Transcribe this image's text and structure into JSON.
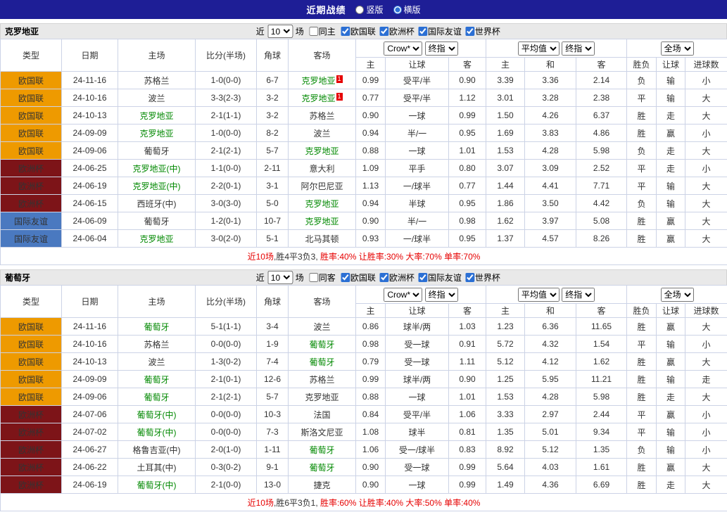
{
  "titlebar": {
    "title": "近期战绩",
    "vertical_label": "竖版",
    "horizontal_label": "横版",
    "selected_layout": "横版"
  },
  "colors": {
    "topbar": "#1e1e96",
    "league-nl": "#ee9a00",
    "league-euro": "#7d1418",
    "league-friendly": "#4a79c0",
    "result-red": "#e60000",
    "result-blue": "#2424dd",
    "result-green": "#009900",
    "team-green": "#008800",
    "score-red": "#ee0000"
  },
  "sections": [
    {
      "team": "克罗地亚",
      "filter": {
        "near_label": "近",
        "count": "10",
        "games_label": "场",
        "same_label": "同主",
        "same_checked": false,
        "competitions": [
          {
            "label": "欧国联",
            "checked": true
          },
          {
            "label": "欧洲杯",
            "checked": true
          },
          {
            "label": "国际友谊",
            "checked": true
          },
          {
            "label": "世界杯",
            "checked": true
          }
        ]
      },
      "header": {
        "type": "类型",
        "date": "日期",
        "home": "主场",
        "score": "比分(半场)",
        "corner": "角球",
        "away": "客场",
        "odds_source": "Crow*",
        "odds_kind": "终指",
        "avg_source": "平均值",
        "avg_kind": "终指",
        "full_source": "全场",
        "sub": [
          "主",
          "让球",
          "客",
          "主",
          "和",
          "客",
          "胜负",
          "让球",
          "进球数"
        ]
      },
      "rows": [
        {
          "type": "欧国联",
          "type_key": "nl",
          "date": "24-11-16",
          "home": "苏格兰",
          "home_green": false,
          "score": "1-0(0-0)",
          "corner": "6-7",
          "away": "克罗地亚",
          "away_green": true,
          "away_badge": "1",
          "odds": [
            "0.99",
            "受平/半",
            "0.90"
          ],
          "avg": [
            "3.39",
            "3.36",
            "2.14"
          ],
          "results": [
            {
              "text": "负",
              "color": "b"
            },
            {
              "text": "输",
              "color": "b"
            },
            {
              "text": "小",
              "color": "b"
            }
          ]
        },
        {
          "type": "欧国联",
          "type_key": "nl",
          "date": "24-10-16",
          "home": "波兰",
          "home_green": false,
          "score": "3-3(2-3)",
          "corner": "3-2",
          "away": "克罗地亚",
          "away_green": true,
          "away_badge": "1",
          "odds": [
            "0.77",
            "受平/半",
            "1.12"
          ],
          "avg": [
            "3.01",
            "3.28",
            "2.38"
          ],
          "results": [
            {
              "text": "平",
              "color": "b"
            },
            {
              "text": "输",
              "color": "b"
            },
            {
              "text": "大",
              "color": "r"
            }
          ]
        },
        {
          "type": "欧国联",
          "type_key": "nl",
          "date": "24-10-13",
          "home": "克罗地亚",
          "home_green": true,
          "score": "2-1(1-1)",
          "corner": "3-2",
          "away": "苏格兰",
          "away_green": false,
          "odds": [
            "0.90",
            "一球",
            "0.99"
          ],
          "avg": [
            "1.50",
            "4.26",
            "6.37"
          ],
          "results": [
            {
              "text": "胜",
              "color": "r"
            },
            {
              "text": "走",
              "color": "g"
            },
            {
              "text": "大",
              "color": "r"
            }
          ]
        },
        {
          "type": "欧国联",
          "type_key": "nl",
          "date": "24-09-09",
          "home": "克罗地亚",
          "home_green": true,
          "score": "1-0(0-0)",
          "corner": "8-2",
          "away": "波兰",
          "away_green": false,
          "odds": [
            "0.94",
            "半/一",
            "0.95"
          ],
          "avg": [
            "1.69",
            "3.83",
            "4.86"
          ],
          "results": [
            {
              "text": "胜",
              "color": "r"
            },
            {
              "text": "赢",
              "color": "r"
            },
            {
              "text": "小",
              "color": "b"
            }
          ]
        },
        {
          "type": "欧国联",
          "type_key": "nl",
          "date": "24-09-06",
          "home": "葡萄牙",
          "home_green": false,
          "score": "2-1(2-1)",
          "corner": "5-7",
          "away": "克罗地亚",
          "away_green": true,
          "odds": [
            "0.88",
            "一球",
            "1.01"
          ],
          "avg": [
            "1.53",
            "4.28",
            "5.98"
          ],
          "results": [
            {
              "text": "负",
              "color": "b"
            },
            {
              "text": "走",
              "color": "g"
            },
            {
              "text": "大",
              "color": "r"
            }
          ]
        },
        {
          "type": "欧洲杯",
          "type_key": "euro",
          "date": "24-06-25",
          "home": "克罗地亚(中)",
          "home_green": true,
          "score": "1-1(0-0)",
          "corner": "2-11",
          "away": "意大利",
          "away_green": false,
          "odds": [
            "1.09",
            "平手",
            "0.80"
          ],
          "avg": [
            "3.07",
            "3.09",
            "2.52"
          ],
          "results": [
            {
              "text": "平",
              "color": "b"
            },
            {
              "text": "走",
              "color": "g"
            },
            {
              "text": "小",
              "color": "b"
            }
          ]
        },
        {
          "type": "欧洲杯",
          "type_key": "euro",
          "date": "24-06-19",
          "home": "克罗地亚(中)",
          "home_green": true,
          "score": "2-2(0-1)",
          "corner": "3-1",
          "away": "阿尔巴尼亚",
          "away_green": false,
          "odds": [
            "1.13",
            "一/球半",
            "0.77"
          ],
          "avg": [
            "1.44",
            "4.41",
            "7.71"
          ],
          "results": [
            {
              "text": "平",
              "color": "b"
            },
            {
              "text": "输",
              "color": "b"
            },
            {
              "text": "大",
              "color": "r"
            }
          ]
        },
        {
          "type": "欧洲杯",
          "type_key": "euro",
          "date": "24-06-15",
          "home": "西班牙(中)",
          "home_green": false,
          "score": "3-0(3-0)",
          "corner": "5-0",
          "away": "克罗地亚",
          "away_green": true,
          "odds": [
            "0.94",
            "半球",
            "0.95"
          ],
          "avg": [
            "1.86",
            "3.50",
            "4.42"
          ],
          "results": [
            {
              "text": "负",
              "color": "b"
            },
            {
              "text": "输",
              "color": "b"
            },
            {
              "text": "大",
              "color": "r"
            }
          ]
        },
        {
          "type": "国际友谊",
          "type_key": "friendly",
          "date": "24-06-09",
          "home": "葡萄牙",
          "home_green": false,
          "score": "1-2(0-1)",
          "corner": "10-7",
          "away": "克罗地亚",
          "away_green": true,
          "odds": [
            "0.90",
            "半/一",
            "0.98"
          ],
          "avg": [
            "1.62",
            "3.97",
            "5.08"
          ],
          "results": [
            {
              "text": "胜",
              "color": "r"
            },
            {
              "text": "赢",
              "color": "r"
            },
            {
              "text": "大",
              "color": "r"
            }
          ]
        },
        {
          "type": "国际友谊",
          "type_key": "friendly",
          "date": "24-06-04",
          "home": "克罗地亚",
          "home_green": true,
          "score": "3-0(2-0)",
          "corner": "5-1",
          "away": "北马其顿",
          "away_green": false,
          "odds": [
            "0.93",
            "一/球半",
            "0.95"
          ],
          "avg": [
            "1.37",
            "4.57",
            "8.26"
          ],
          "results": [
            {
              "text": "胜",
              "color": "r"
            },
            {
              "text": "赢",
              "color": "r"
            },
            {
              "text": "大",
              "color": "r"
            }
          ]
        }
      ],
      "summary": [
        {
          "text": "近10场",
          "red": true
        },
        {
          "text": ",胜4平3负3, ",
          "red": false
        },
        {
          "text": "胜率:40% 让胜率:30% 大率:70% 单率:70%",
          "red": true
        }
      ]
    },
    {
      "team": "葡萄牙",
      "filter": {
        "near_label": "近",
        "count": "10",
        "games_label": "场",
        "same_label": "同客",
        "same_checked": false,
        "competitions": [
          {
            "label": "欧国联",
            "checked": true
          },
          {
            "label": "欧洲杯",
            "checked": true
          },
          {
            "label": "国际友谊",
            "checked": true
          },
          {
            "label": "世界杯",
            "checked": true
          }
        ]
      },
      "header": {
        "type": "类型",
        "date": "日期",
        "home": "主场",
        "score": "比分(半场)",
        "corner": "角球",
        "away": "客场",
        "odds_source": "Crow*",
        "odds_kind": "终指",
        "avg_source": "平均值",
        "avg_kind": "终指",
        "full_source": "全场",
        "sub": [
          "主",
          "让球",
          "客",
          "主",
          "和",
          "客",
          "胜负",
          "让球",
          "进球数"
        ]
      },
      "rows": [
        {
          "type": "欧国联",
          "type_key": "nl",
          "date": "24-11-16",
          "home": "葡萄牙",
          "home_green": true,
          "score": "5-1(1-1)",
          "corner": "3-4",
          "away": "波兰",
          "away_green": false,
          "odds": [
            "0.86",
            "球半/两",
            "1.03"
          ],
          "avg": [
            "1.23",
            "6.36",
            "11.65"
          ],
          "results": [
            {
              "text": "胜",
              "color": "r"
            },
            {
              "text": "赢",
              "color": "r"
            },
            {
              "text": "大",
              "color": "r"
            }
          ]
        },
        {
          "type": "欧国联",
          "type_key": "nl",
          "date": "24-10-16",
          "home": "苏格兰",
          "home_green": false,
          "score": "0-0(0-0)",
          "corner": "1-9",
          "away": "葡萄牙",
          "away_green": true,
          "odds": [
            "0.98",
            "受一球",
            "0.91"
          ],
          "avg": [
            "5.72",
            "4.32",
            "1.54"
          ],
          "results": [
            {
              "text": "平",
              "color": "b"
            },
            {
              "text": "输",
              "color": "b"
            },
            {
              "text": "小",
              "color": "b"
            }
          ]
        },
        {
          "type": "欧国联",
          "type_key": "nl",
          "date": "24-10-13",
          "home": "波兰",
          "home_green": false,
          "score": "1-3(0-2)",
          "corner": "7-4",
          "away": "葡萄牙",
          "away_green": true,
          "odds": [
            "0.79",
            "受一球",
            "1.11"
          ],
          "avg": [
            "5.12",
            "4.12",
            "1.62"
          ],
          "results": [
            {
              "text": "胜",
              "color": "r"
            },
            {
              "text": "赢",
              "color": "r"
            },
            {
              "text": "大",
              "color": "r"
            }
          ]
        },
        {
          "type": "欧国联",
          "type_key": "nl",
          "date": "24-09-09",
          "home": "葡萄牙",
          "home_green": true,
          "score": "2-1(0-1)",
          "corner": "12-6",
          "away": "苏格兰",
          "away_green": false,
          "odds": [
            "0.99",
            "球半/两",
            "0.90"
          ],
          "avg": [
            "1.25",
            "5.95",
            "11.21"
          ],
          "results": [
            {
              "text": "胜",
              "color": "r"
            },
            {
              "text": "输",
              "color": "b"
            },
            {
              "text": "走",
              "color": "g"
            }
          ]
        },
        {
          "type": "欧国联",
          "type_key": "nl",
          "date": "24-09-06",
          "home": "葡萄牙",
          "home_green": true,
          "score": "2-1(2-1)",
          "corner": "5-7",
          "away": "克罗地亚",
          "away_green": false,
          "odds": [
            "0.88",
            "一球",
            "1.01"
          ],
          "avg": [
            "1.53",
            "4.28",
            "5.98"
          ],
          "results": [
            {
              "text": "胜",
              "color": "r"
            },
            {
              "text": "走",
              "color": "g"
            },
            {
              "text": "大",
              "color": "r"
            }
          ]
        },
        {
          "type": "欧洲杯",
          "type_key": "euro",
          "date": "24-07-06",
          "home": "葡萄牙(中)",
          "home_green": true,
          "score": "0-0(0-0)",
          "corner": "10-3",
          "away": "法国",
          "away_green": false,
          "odds": [
            "0.84",
            "受平/半",
            "1.06"
          ],
          "avg": [
            "3.33",
            "2.97",
            "2.44"
          ],
          "results": [
            {
              "text": "平",
              "color": "b"
            },
            {
              "text": "赢",
              "color": "r"
            },
            {
              "text": "小",
              "color": "b"
            }
          ]
        },
        {
          "type": "欧洲杯",
          "type_key": "euro",
          "date": "24-07-02",
          "home": "葡萄牙(中)",
          "home_green": true,
          "score": "0-0(0-0)",
          "corner": "7-3",
          "away": "斯洛文尼亚",
          "away_green": false,
          "odds": [
            "1.08",
            "球半",
            "0.81"
          ],
          "avg": [
            "1.35",
            "5.01",
            "9.34"
          ],
          "results": [
            {
              "text": "平",
              "color": "b"
            },
            {
              "text": "输",
              "color": "b"
            },
            {
              "text": "小",
              "color": "b"
            }
          ]
        },
        {
          "type": "欧洲杯",
          "type_key": "euro",
          "date": "24-06-27",
          "home": "格鲁吉亚(中)",
          "home_green": false,
          "score": "2-0(1-0)",
          "corner": "1-11",
          "away": "葡萄牙",
          "away_green": true,
          "odds": [
            "1.06",
            "受一/球半",
            "0.83"
          ],
          "avg": [
            "8.92",
            "5.12",
            "1.35"
          ],
          "results": [
            {
              "text": "负",
              "color": "b"
            },
            {
              "text": "输",
              "color": "b"
            },
            {
              "text": "小",
              "color": "b"
            }
          ]
        },
        {
          "type": "欧洲杯",
          "type_key": "euro",
          "date": "24-06-22",
          "home": "土耳其(中)",
          "home_green": false,
          "score": "0-3(0-2)",
          "corner": "9-1",
          "away": "葡萄牙",
          "away_green": true,
          "odds": [
            "0.90",
            "受一球",
            "0.99"
          ],
          "avg": [
            "5.64",
            "4.03",
            "1.61"
          ],
          "results": [
            {
              "text": "胜",
              "color": "r"
            },
            {
              "text": "赢",
              "color": "r"
            },
            {
              "text": "大",
              "color": "r"
            }
          ]
        },
        {
          "type": "欧洲杯",
          "type_key": "euro",
          "date": "24-06-19",
          "home": "葡萄牙(中)",
          "home_green": true,
          "score": "2-1(0-0)",
          "corner": "13-0",
          "away": "捷克",
          "away_green": false,
          "odds": [
            "0.90",
            "一球",
            "0.99"
          ],
          "avg": [
            "1.49",
            "4.36",
            "6.69"
          ],
          "results": [
            {
              "text": "胜",
              "color": "r"
            },
            {
              "text": "走",
              "color": "g"
            },
            {
              "text": "大",
              "color": "r"
            }
          ]
        }
      ],
      "summary": [
        {
          "text": "近10场",
          "red": true
        },
        {
          "text": ",胜6平3负1, ",
          "red": false
        },
        {
          "text": "胜率:60% 让胜率:40% 大率:50% 单率:40%",
          "red": true
        }
      ]
    }
  ]
}
